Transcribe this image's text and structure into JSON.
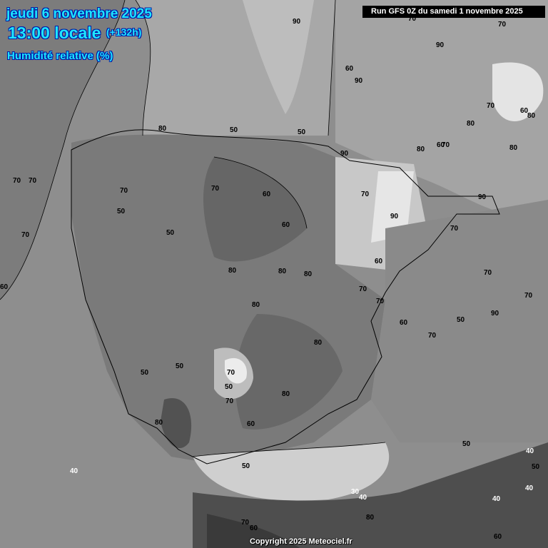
{
  "header": {
    "date": "jeudi 6 novembre 2025",
    "time": "13:00 locale",
    "lead": "(+132h)",
    "variable": "Humidité relative (%)"
  },
  "run_info": "Run GFS 0Z du samedi 1 novembre 2025",
  "copyright": "Copyright 2025 Meteociel.fr",
  "colors": {
    "title": "#1ee6ff",
    "title_outline": "#0018a8"
  },
  "contour_labels": [
    "90",
    "70",
    "90",
    "70",
    "60",
    "90",
    "70",
    "60",
    "80",
    "80",
    "80",
    "80",
    "60",
    "70",
    "90",
    "80",
    "50",
    "50",
    "70",
    "70",
    "70",
    "70",
    "60",
    "50",
    "70",
    "90",
    "90",
    "60",
    "70",
    "50",
    "70",
    "80",
    "80",
    "80",
    "60",
    "70",
    "60",
    "70",
    "80",
    "70",
    "70",
    "50",
    "90",
    "60",
    "70",
    "80",
    "70",
    "50",
    "50",
    "50",
    "70",
    "80",
    "80",
    "60",
    "50",
    "40",
    "40",
    "50",
    "50",
    "40",
    "40",
    "30",
    "40",
    "80",
    "70",
    "60",
    "60"
  ]
}
